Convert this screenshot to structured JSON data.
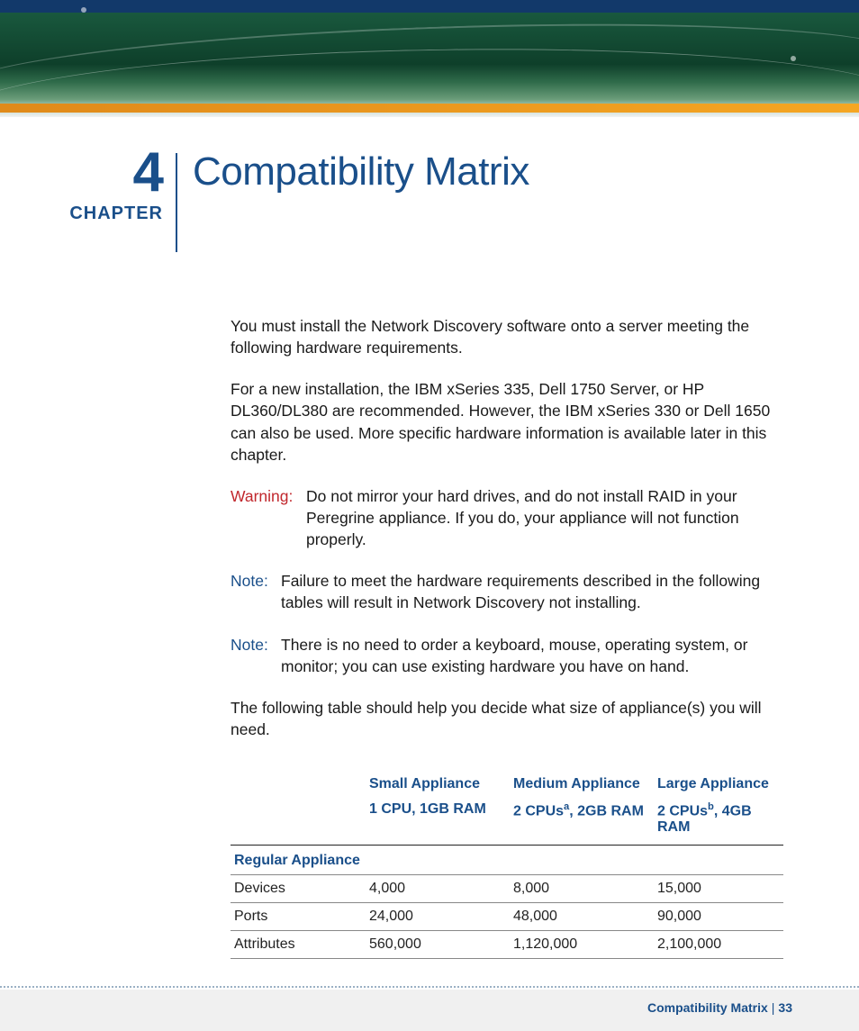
{
  "chapter": {
    "number": "4",
    "label": "CHAPTER",
    "title": "Compatibility Matrix"
  },
  "body": {
    "para1": "You must install the Network Discovery software onto a server meeting the following hardware requirements.",
    "para2": "For a new installation, the IBM xSeries 335, Dell 1750 Server, or HP DL360/DL380 are recommended. However, the IBM xSeries 330 or Dell 1650 can also be used. More specific hardware information is available later in this chapter.",
    "warning": {
      "label": "Warning:",
      "text": "Do not mirror your hard drives, and do not install RAID in your Peregrine appliance. If you do, your appliance will not function properly."
    },
    "note1": {
      "label": "Note:",
      "text": "Failure to meet the hardware requirements described in the following tables will result in Network Discovery not installing."
    },
    "note2": {
      "label": "Note:",
      "text": "There is no need to order a keyboard, mouse, operating system, or monitor; you can use existing hardware you have on hand."
    },
    "para3": "The following table should help you decide what size of appliance(s) you will need."
  },
  "table": {
    "header1": {
      "small": "Small Appliance",
      "medium": "Medium Appliance",
      "large": "Large Appliance"
    },
    "header2": {
      "small": "1 CPU, 1GB RAM",
      "medium_pre": "2 CPUs",
      "medium_sup": "a",
      "medium_post": ", 2GB RAM",
      "large_pre": "2 CPUs",
      "large_sup": "b",
      "large_post": ", 4GB RAM"
    },
    "section": "Regular Appliance",
    "rows": [
      {
        "label": "Devices",
        "small": "4,000",
        "medium": "8,000",
        "large": "15,000"
      },
      {
        "label": "Ports",
        "small": "24,000",
        "medium": "48,000",
        "large": "90,000"
      },
      {
        "label": "Attributes",
        "small": "560,000",
        "medium": "1,120,000",
        "large": "2,100,000"
      }
    ]
  },
  "footer": {
    "title": "Compatibility Matrix",
    "page": "33"
  },
  "chart_data": {
    "type": "table",
    "title": "Regular Appliance",
    "columns": [
      "",
      "Small Appliance (1 CPU, 1GB RAM)",
      "Medium Appliance (2 CPUs, 2GB RAM)",
      "Large Appliance (2 CPUs, 4GB RAM)"
    ],
    "rows": [
      [
        "Devices",
        4000,
        8000,
        15000
      ],
      [
        "Ports",
        24000,
        48000,
        90000
      ],
      [
        "Attributes",
        560000,
        1120000,
        2100000
      ]
    ]
  }
}
